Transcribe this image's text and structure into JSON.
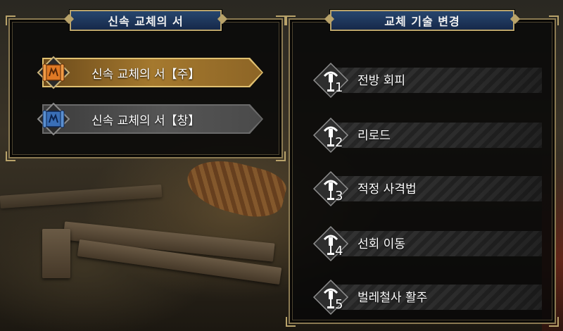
{
  "left_panel": {
    "header": "신속 교체의 서",
    "books": [
      {
        "label": "신속 교체의 서【주】",
        "selected": true,
        "icon": "orange-scroll-icon",
        "color": "#e07a25"
      },
      {
        "label": "신속 교체의 서【창】",
        "selected": false,
        "icon": "blue-scroll-icon",
        "color": "#3a6fb7"
      }
    ]
  },
  "right_panel": {
    "header": "교체 기술 변경",
    "skills": [
      {
        "number": "1",
        "label": "전방 회피",
        "icon": "bowgun-skill-icon"
      },
      {
        "number": "2",
        "label": "리로드",
        "icon": "bowgun-skill-icon"
      },
      {
        "number": "3",
        "label": "적정 사격법",
        "icon": "bowgun-skill-icon"
      },
      {
        "number": "4",
        "label": "선회 이동",
        "icon": "bowgun-skill-icon"
      },
      {
        "number": "5",
        "label": "벌레철사 활주",
        "icon": "bowgun-skill-icon"
      }
    ]
  },
  "colors": {
    "frame_gold": "#b9a36a",
    "header_blue": "#27466e",
    "selected_gold": "#a5792e"
  }
}
